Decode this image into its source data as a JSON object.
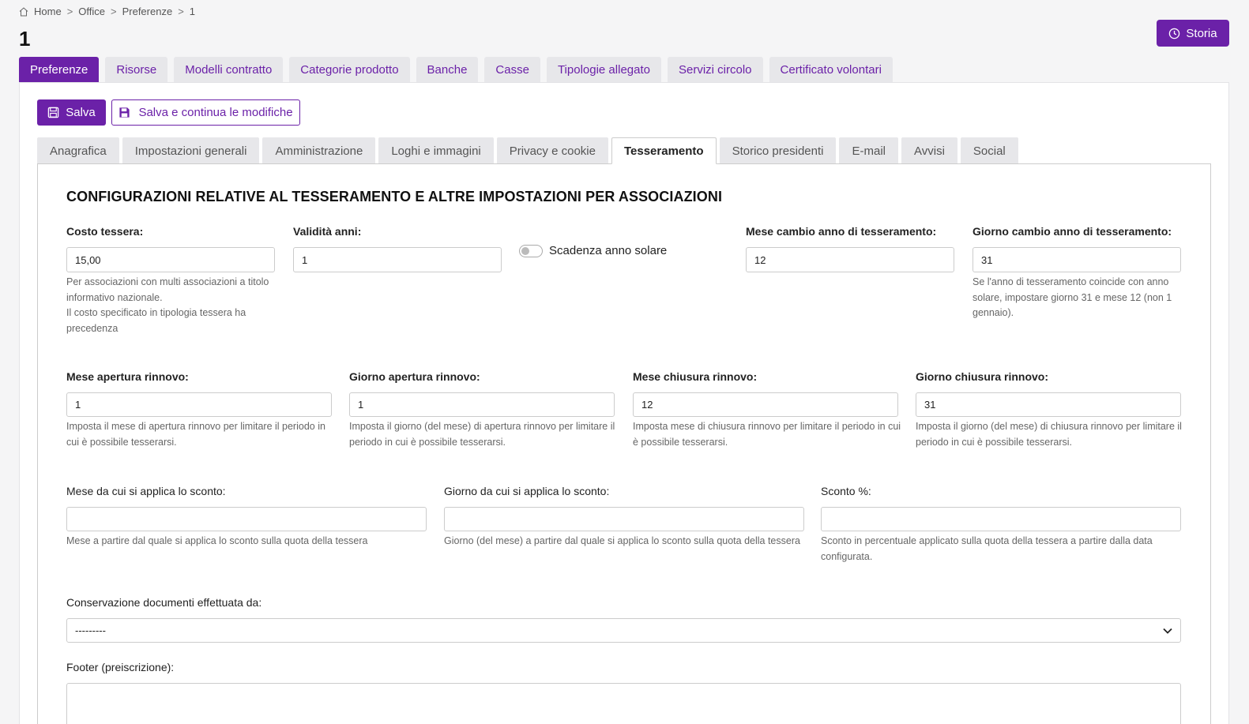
{
  "breadcrumb": {
    "home": "Home",
    "office": "Office",
    "preferenze": "Preferenze",
    "current": "1",
    "separator": ">"
  },
  "page_title": "1",
  "storia_label": "Storia",
  "top_tabs": [
    {
      "label": "Preferenze",
      "active": true
    },
    {
      "label": "Risorse"
    },
    {
      "label": "Modelli contratto"
    },
    {
      "label": "Categorie prodotto"
    },
    {
      "label": "Banche"
    },
    {
      "label": "Casse"
    },
    {
      "label": "Tipologie allegato"
    },
    {
      "label": "Servizi circolo"
    },
    {
      "label": "Certificato volontari"
    }
  ],
  "actions": {
    "save_label": "Salva",
    "save_continue_label": "Salva e continua le modifiche"
  },
  "sub_tabs": [
    {
      "label": "Anagrafica"
    },
    {
      "label": "Impostazioni generali"
    },
    {
      "label": "Amministrazione"
    },
    {
      "label": "Loghi e immagini"
    },
    {
      "label": "Privacy e cookie"
    },
    {
      "label": "Tesseramento",
      "active": true
    },
    {
      "label": "Storico presidenti"
    },
    {
      "label": "E-mail"
    },
    {
      "label": "Avvisi"
    },
    {
      "label": "Social"
    }
  ],
  "section_title": "CONFIGURAZIONI RELATIVE AL TESSERAMENTO E ALTRE IMPOSTAZIONI PER ASSOCIAZIONI",
  "fields": {
    "costo_tessera": {
      "label": "Costo tessera:",
      "value": "15,00",
      "help_1": "Per associazioni con multi associazioni a titolo",
      "help_2": "informativo nazionale.",
      "help_3": "Il costo specificato in tipologia tessera ha",
      "help_4": "precedenza"
    },
    "validita_anni": {
      "label": "Validità anni:",
      "value": "1"
    },
    "scadenza_anno_solare": {
      "label": "Scadenza anno solare",
      "checked": false
    },
    "mese_cambio": {
      "label": "Mese cambio anno di tesseramento:",
      "value": "12"
    },
    "giorno_cambio": {
      "label": "Giorno cambio anno di tesseramento:",
      "value": "31",
      "help_1": "Se l'anno di tesseramento coincide con anno",
      "help_2": "solare, impostare giorno 31 e mese 12 (non 1",
      "help_3": "gennaio)."
    },
    "mese_apertura": {
      "label": "Mese apertura rinnovo:",
      "value": "1",
      "help_1": "Imposta il mese di apertura rinnovo per limitare il periodo in",
      "help_2": "cui è possibile tesserarsi."
    },
    "giorno_apertura": {
      "label": "Giorno apertura rinnovo:",
      "value": "1",
      "help_1": "Imposta il giorno (del mese) di apertura rinnovo per limitare il",
      "help_2": "periodo in cui è possibile tesserarsi."
    },
    "mese_chiusura": {
      "label": "Mese chiusura rinnovo:",
      "value": "12",
      "help_1": "Imposta mese di chiusura rinnovo per limitare il periodo in cui",
      "help_2": "è possibile tesserarsi."
    },
    "giorno_chiusura": {
      "label": "Giorno chiusura rinnovo:",
      "value": "31",
      "help_1": "Imposta il giorno (del mese) di chiusura rinnovo per limitare il",
      "help_2": "periodo in cui è possibile tesserarsi."
    },
    "mese_sconto": {
      "label": "Mese da cui si applica lo sconto:",
      "value": "",
      "help_1": "Mese a partire dal quale si applica lo sconto sulla quota della tessera"
    },
    "giorno_sconto": {
      "label": "Giorno da cui si applica lo sconto:",
      "value": "",
      "help_1": "Giorno (del mese) a partire dal quale si applica lo sconto sulla quota della tessera"
    },
    "sconto_percent": {
      "label": "Sconto %:",
      "value": "",
      "help_1": "Sconto in percentuale applicato sulla quota della tessera a partire dalla data",
      "help_2": "configurata."
    },
    "conservazione": {
      "label": "Conservazione documenti effettuata da:",
      "value": "---------"
    },
    "footer": {
      "label": "Footer (preiscrizione):",
      "value": ""
    }
  },
  "colors": {
    "accent": "#6b21a8",
    "tab_bg": "#e7e7ea",
    "page_bg": "#f5f5f6"
  },
  "icons": [
    "home-icon",
    "clock-icon",
    "save-icon",
    "floppy-icon",
    "chevron-down-icon",
    "toggle-switch"
  ]
}
